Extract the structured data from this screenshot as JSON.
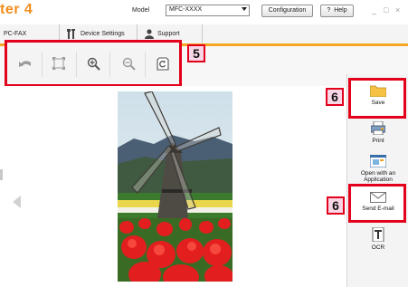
{
  "app": {
    "title": "ter 4"
  },
  "header": {
    "model_label": "Model",
    "model_value": "MFC-XXXX",
    "configuration_label": "Configuration",
    "help_label": "Help",
    "help_prefix": "?",
    "window_controls": [
      "_",
      "□",
      "×"
    ]
  },
  "tabs": [
    {
      "label": "PC-FAX",
      "icon": ""
    },
    {
      "label": "Device Settings",
      "icon": "tools-icon"
    },
    {
      "label": "Support",
      "icon": "person-icon"
    }
  ],
  "toolbar": {
    "callout": "5",
    "tools": [
      "rotate-icon",
      "fit-page-icon",
      "zoom-in-icon",
      "zoom-out-icon",
      "refresh-icon"
    ]
  },
  "side": {
    "callouts": [
      "6",
      "6"
    ],
    "buttons": [
      {
        "label": "Save",
        "icon": "folder-icon"
      },
      {
        "label": "Print",
        "icon": "printer-icon"
      },
      {
        "label": "Open with an Application",
        "icon": "app-window-icon"
      },
      {
        "label": "Send E-mail",
        "icon": "envelope-icon"
      },
      {
        "label": "OCR",
        "icon": "ocr-document-icon"
      }
    ]
  },
  "colors": {
    "accent": "#f5a623",
    "highlight": "#e3001b",
    "callout_fill": "#f9d6e6",
    "title": "#f28c1c"
  }
}
